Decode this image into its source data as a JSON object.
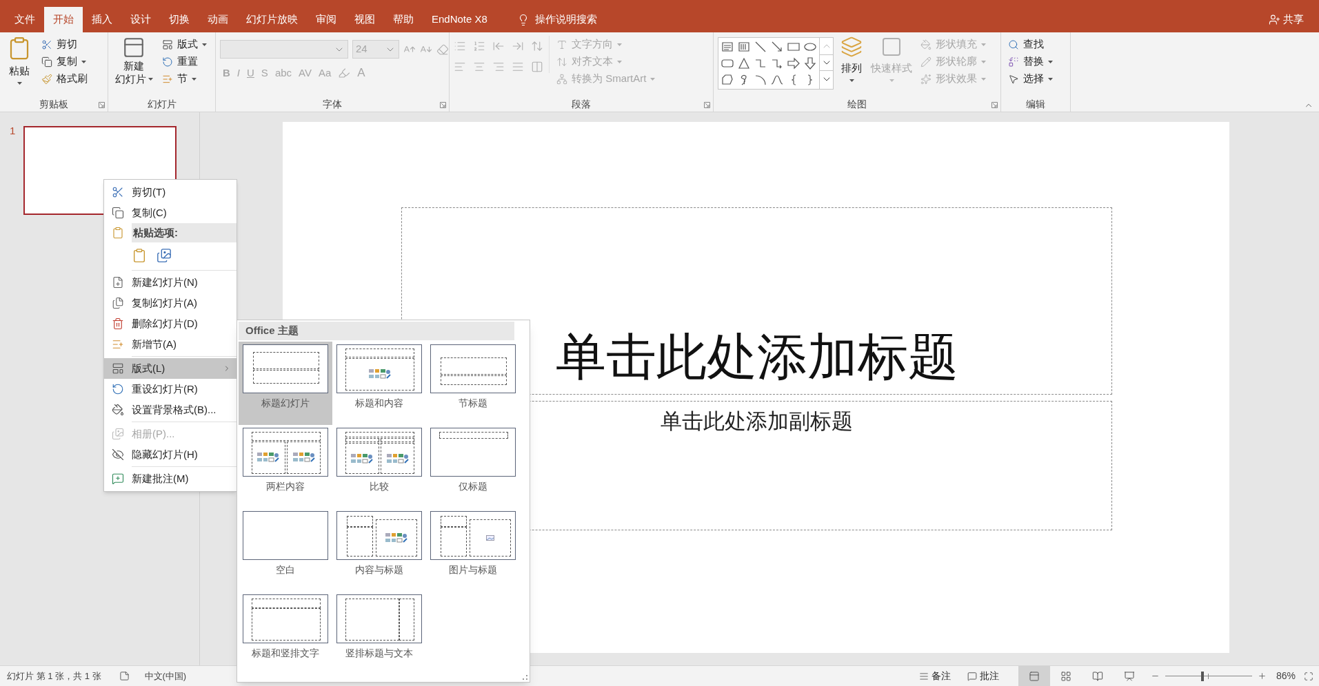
{
  "tabs": [
    {
      "label": "文件",
      "selected": false
    },
    {
      "label": "开始",
      "selected": true
    },
    {
      "label": "插入",
      "selected": false
    },
    {
      "label": "设计",
      "selected": false
    },
    {
      "label": "切换",
      "selected": false
    },
    {
      "label": "动画",
      "selected": false
    },
    {
      "label": "幻灯片放映",
      "selected": false
    },
    {
      "label": "审阅",
      "selected": false
    },
    {
      "label": "视图",
      "selected": false
    },
    {
      "label": "帮助",
      "selected": false
    },
    {
      "label": "EndNote X8",
      "selected": false
    }
  ],
  "tell_me": "操作说明搜索",
  "share": "共享",
  "clipboard": {
    "label": "剪贴板",
    "paste": "粘贴",
    "items": [
      {
        "kind": "cut",
        "label": "剪切"
      },
      {
        "kind": "copy",
        "label": "复制"
      },
      {
        "kind": "painter",
        "label": "格式刷"
      }
    ]
  },
  "slides_group": {
    "label": "幻灯片",
    "new_slide": [
      "新建",
      "幻灯片"
    ],
    "items": [
      {
        "kind": "layout",
        "label": "版式"
      },
      {
        "kind": "reset",
        "label": "重置"
      },
      {
        "kind": "section",
        "label": "节"
      }
    ]
  },
  "font": {
    "label": "字体",
    "size": "24",
    "disabled": true,
    "buttons": [
      "B",
      "I",
      "U",
      "S",
      "abc",
      "AV",
      "Aa"
    ],
    "color_button": "A"
  },
  "paragraph": {
    "label": "段落",
    "items": [
      {
        "kind": "direction",
        "label": "文字方向",
        "disabled": true
      },
      {
        "kind": "align",
        "label": "对齐文本",
        "disabled": true
      },
      {
        "kind": "smartart",
        "label": "转换为 SmartArt",
        "disabled": true
      }
    ]
  },
  "drawing": {
    "label": "绘图",
    "arrange": "排列",
    "quick_styles": {
      "label": "快速样式",
      "disabled": true
    },
    "items": [
      {
        "kind": "fill",
        "label": "形状填充",
        "disabled": true
      },
      {
        "kind": "outline",
        "label": "形状轮廓",
        "disabled": true
      },
      {
        "kind": "effects",
        "label": "形状效果",
        "disabled": true
      }
    ]
  },
  "editing": {
    "label": "编辑",
    "items": [
      {
        "kind": "find",
        "label": "查找"
      },
      {
        "kind": "replace",
        "label": "替换"
      },
      {
        "kind": "select",
        "label": "选择"
      }
    ]
  },
  "slide_pane": {
    "slides": [
      {
        "number": "1",
        "selected": true
      }
    ]
  },
  "slide": {
    "title": "单击此处添加标题",
    "subtitle": "单击此处添加副标题"
  },
  "context_menu": {
    "items": [
      {
        "kind": "cut",
        "label": "剪切(T)",
        "disabled": false,
        "selected": false
      },
      {
        "kind": "copy",
        "label": "复制(C)",
        "disabled": false,
        "selected": false
      },
      {
        "kind": "paste_header",
        "label": "粘贴选项:"
      },
      {
        "kind": "paste_options"
      },
      {
        "kind": "separator"
      },
      {
        "kind": "new_slide",
        "label": "新建幻灯片(N)",
        "disabled": false,
        "selected": false
      },
      {
        "kind": "duplicate",
        "label": "复制幻灯片(A)",
        "disabled": false,
        "selected": false
      },
      {
        "kind": "delete",
        "label": "删除幻灯片(D)",
        "disabled": false,
        "selected": false
      },
      {
        "kind": "section",
        "label": "新增节(A)",
        "disabled": false,
        "selected": false
      },
      {
        "kind": "separator"
      },
      {
        "kind": "layout",
        "label": "版式(L)",
        "disabled": false,
        "selected": true
      },
      {
        "kind": "reset",
        "label": "重设幻灯片(R)",
        "disabled": false,
        "selected": false
      },
      {
        "kind": "background",
        "label": "设置背景格式(B)...",
        "disabled": false,
        "selected": false
      },
      {
        "kind": "separator"
      },
      {
        "kind": "album",
        "label": "相册(P)...",
        "disabled": true,
        "selected": false
      },
      {
        "kind": "hide",
        "label": "隐藏幻灯片(H)",
        "disabled": false,
        "selected": false
      },
      {
        "kind": "separator"
      },
      {
        "kind": "comment",
        "label": "新建批注(M)",
        "disabled": false,
        "selected": false
      }
    ]
  },
  "layout_gallery": {
    "title": "Office 主题",
    "layouts": [
      {
        "kind": "title",
        "name": "标题幻灯片",
        "selected": true
      },
      {
        "kind": "title_content",
        "name": "标题和内容",
        "selected": false
      },
      {
        "kind": "section",
        "name": "节标题",
        "selected": false
      },
      {
        "kind": "two_content",
        "name": "两栏内容",
        "selected": false
      },
      {
        "kind": "comparison",
        "name": "比较",
        "selected": false
      },
      {
        "kind": "title_only",
        "name": "仅标题",
        "selected": false
      },
      {
        "kind": "blank",
        "name": "空白",
        "selected": false
      },
      {
        "kind": "content_caption",
        "name": "内容与标题",
        "selected": false
      },
      {
        "kind": "picture_caption",
        "name": "图片与标题",
        "selected": false
      },
      {
        "kind": "vertical_text",
        "name": "标题和竖排文字",
        "selected": false
      },
      {
        "kind": "vertical_title",
        "name": "竖排标题与文本",
        "selected": false
      }
    ]
  },
  "status_bar": {
    "slide_info": "幻灯片 第 1 张，共 1 张",
    "language": "中文(中国)",
    "notes": "备注",
    "comments": "批注",
    "views": [
      {
        "kind": "normal",
        "selected": true
      },
      {
        "kind": "sorter",
        "selected": false
      },
      {
        "kind": "reading",
        "selected": false
      },
      {
        "kind": "show",
        "selected": false
      }
    ],
    "zoom": {
      "level": 0.43,
      "reading": "86%"
    }
  }
}
